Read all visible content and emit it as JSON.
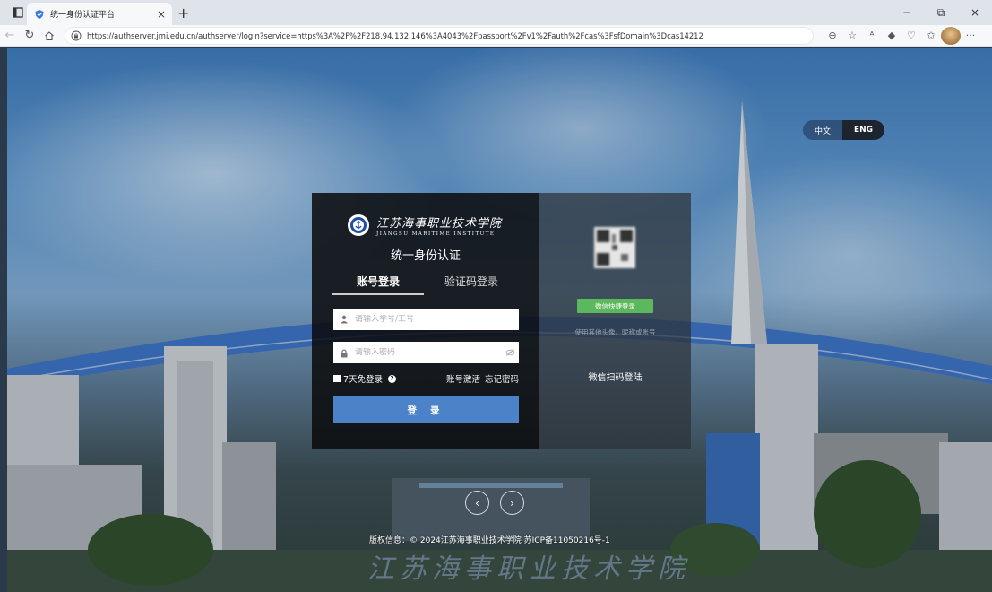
{
  "browser": {
    "tab_title": "统一身份认证平台",
    "tab_close": "×",
    "new_tab": "+",
    "url": "https://authserver.jmi.edu.cn/authserver/login?service=https%3A%2F%2F218.94.132.146%3A4043%2Fpassport%2Fv1%2Fauth%2Fcas%3FsfDomain%3Dcas14212",
    "window_controls": {
      "minimize": "−",
      "restore": "⧉",
      "close": "×"
    }
  },
  "lang": {
    "chinese": "中文",
    "english": "ENG"
  },
  "logo": {
    "name_cn": "江苏海事职业技术学院",
    "name_en": "JIANGSU MARITIME INSTITUTE"
  },
  "login": {
    "title": "统一身份认证",
    "tab_account": "账号登录",
    "tab_code": "验证码登录",
    "username_placeholder": "请输入学号/工号",
    "password_placeholder": "请输入密码",
    "remember": "7天免登录",
    "activate": "账号激活",
    "forgot": "忘记密码",
    "submit": "登 录"
  },
  "wechat": {
    "quick_login": "微信快捷登录",
    "other_account": "使用其他头像、昵称或账号",
    "scan_login": "微信扫码登陆"
  },
  "footer": {
    "copyright": "版权信息：© 2024江苏海事职业技术学院 苏ICP备11050216号-1"
  },
  "carousel": {
    "prev": "‹",
    "next": "›"
  },
  "colors": {
    "login_button": "#4b82c8",
    "wechat_button": "#5cb85c",
    "card_bg": "#0a0a0c"
  }
}
